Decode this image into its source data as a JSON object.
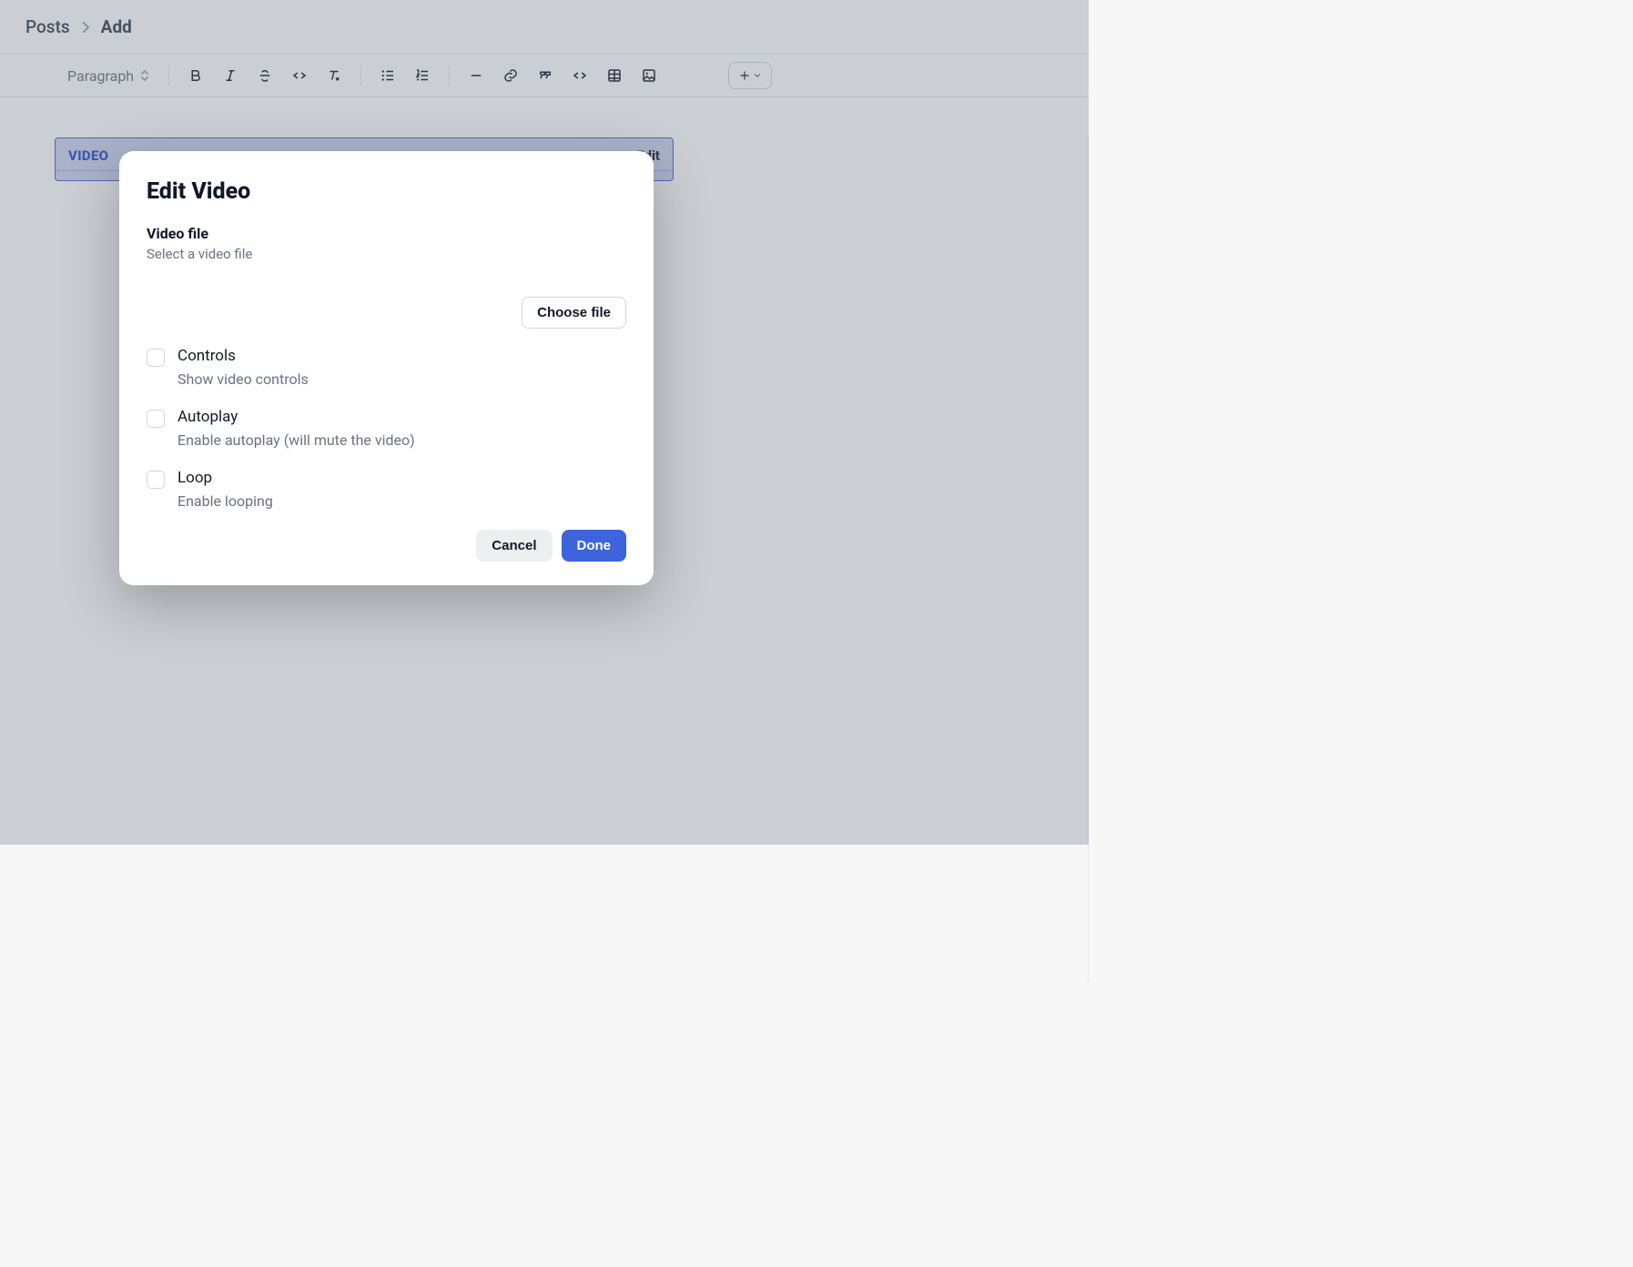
{
  "breadcrumb": {
    "root": "Posts",
    "current": "Add"
  },
  "toolbar": {
    "style_label": "Paragraph"
  },
  "video_block": {
    "tag": "VIDEO",
    "edit_label": "Edit"
  },
  "modal": {
    "title": "Edit Video",
    "video_file": {
      "label": "Video file",
      "help": "Select a video file"
    },
    "choose_file_label": "Choose file",
    "options": {
      "controls": {
        "label": "Controls",
        "help": "Show video controls",
        "checked": false
      },
      "autoplay": {
        "label": "Autoplay",
        "help": "Enable autoplay (will mute the video)",
        "checked": false
      },
      "loop": {
        "label": "Loop",
        "help": "Enable looping",
        "checked": false
      }
    },
    "cancel_label": "Cancel",
    "done_label": "Done"
  }
}
